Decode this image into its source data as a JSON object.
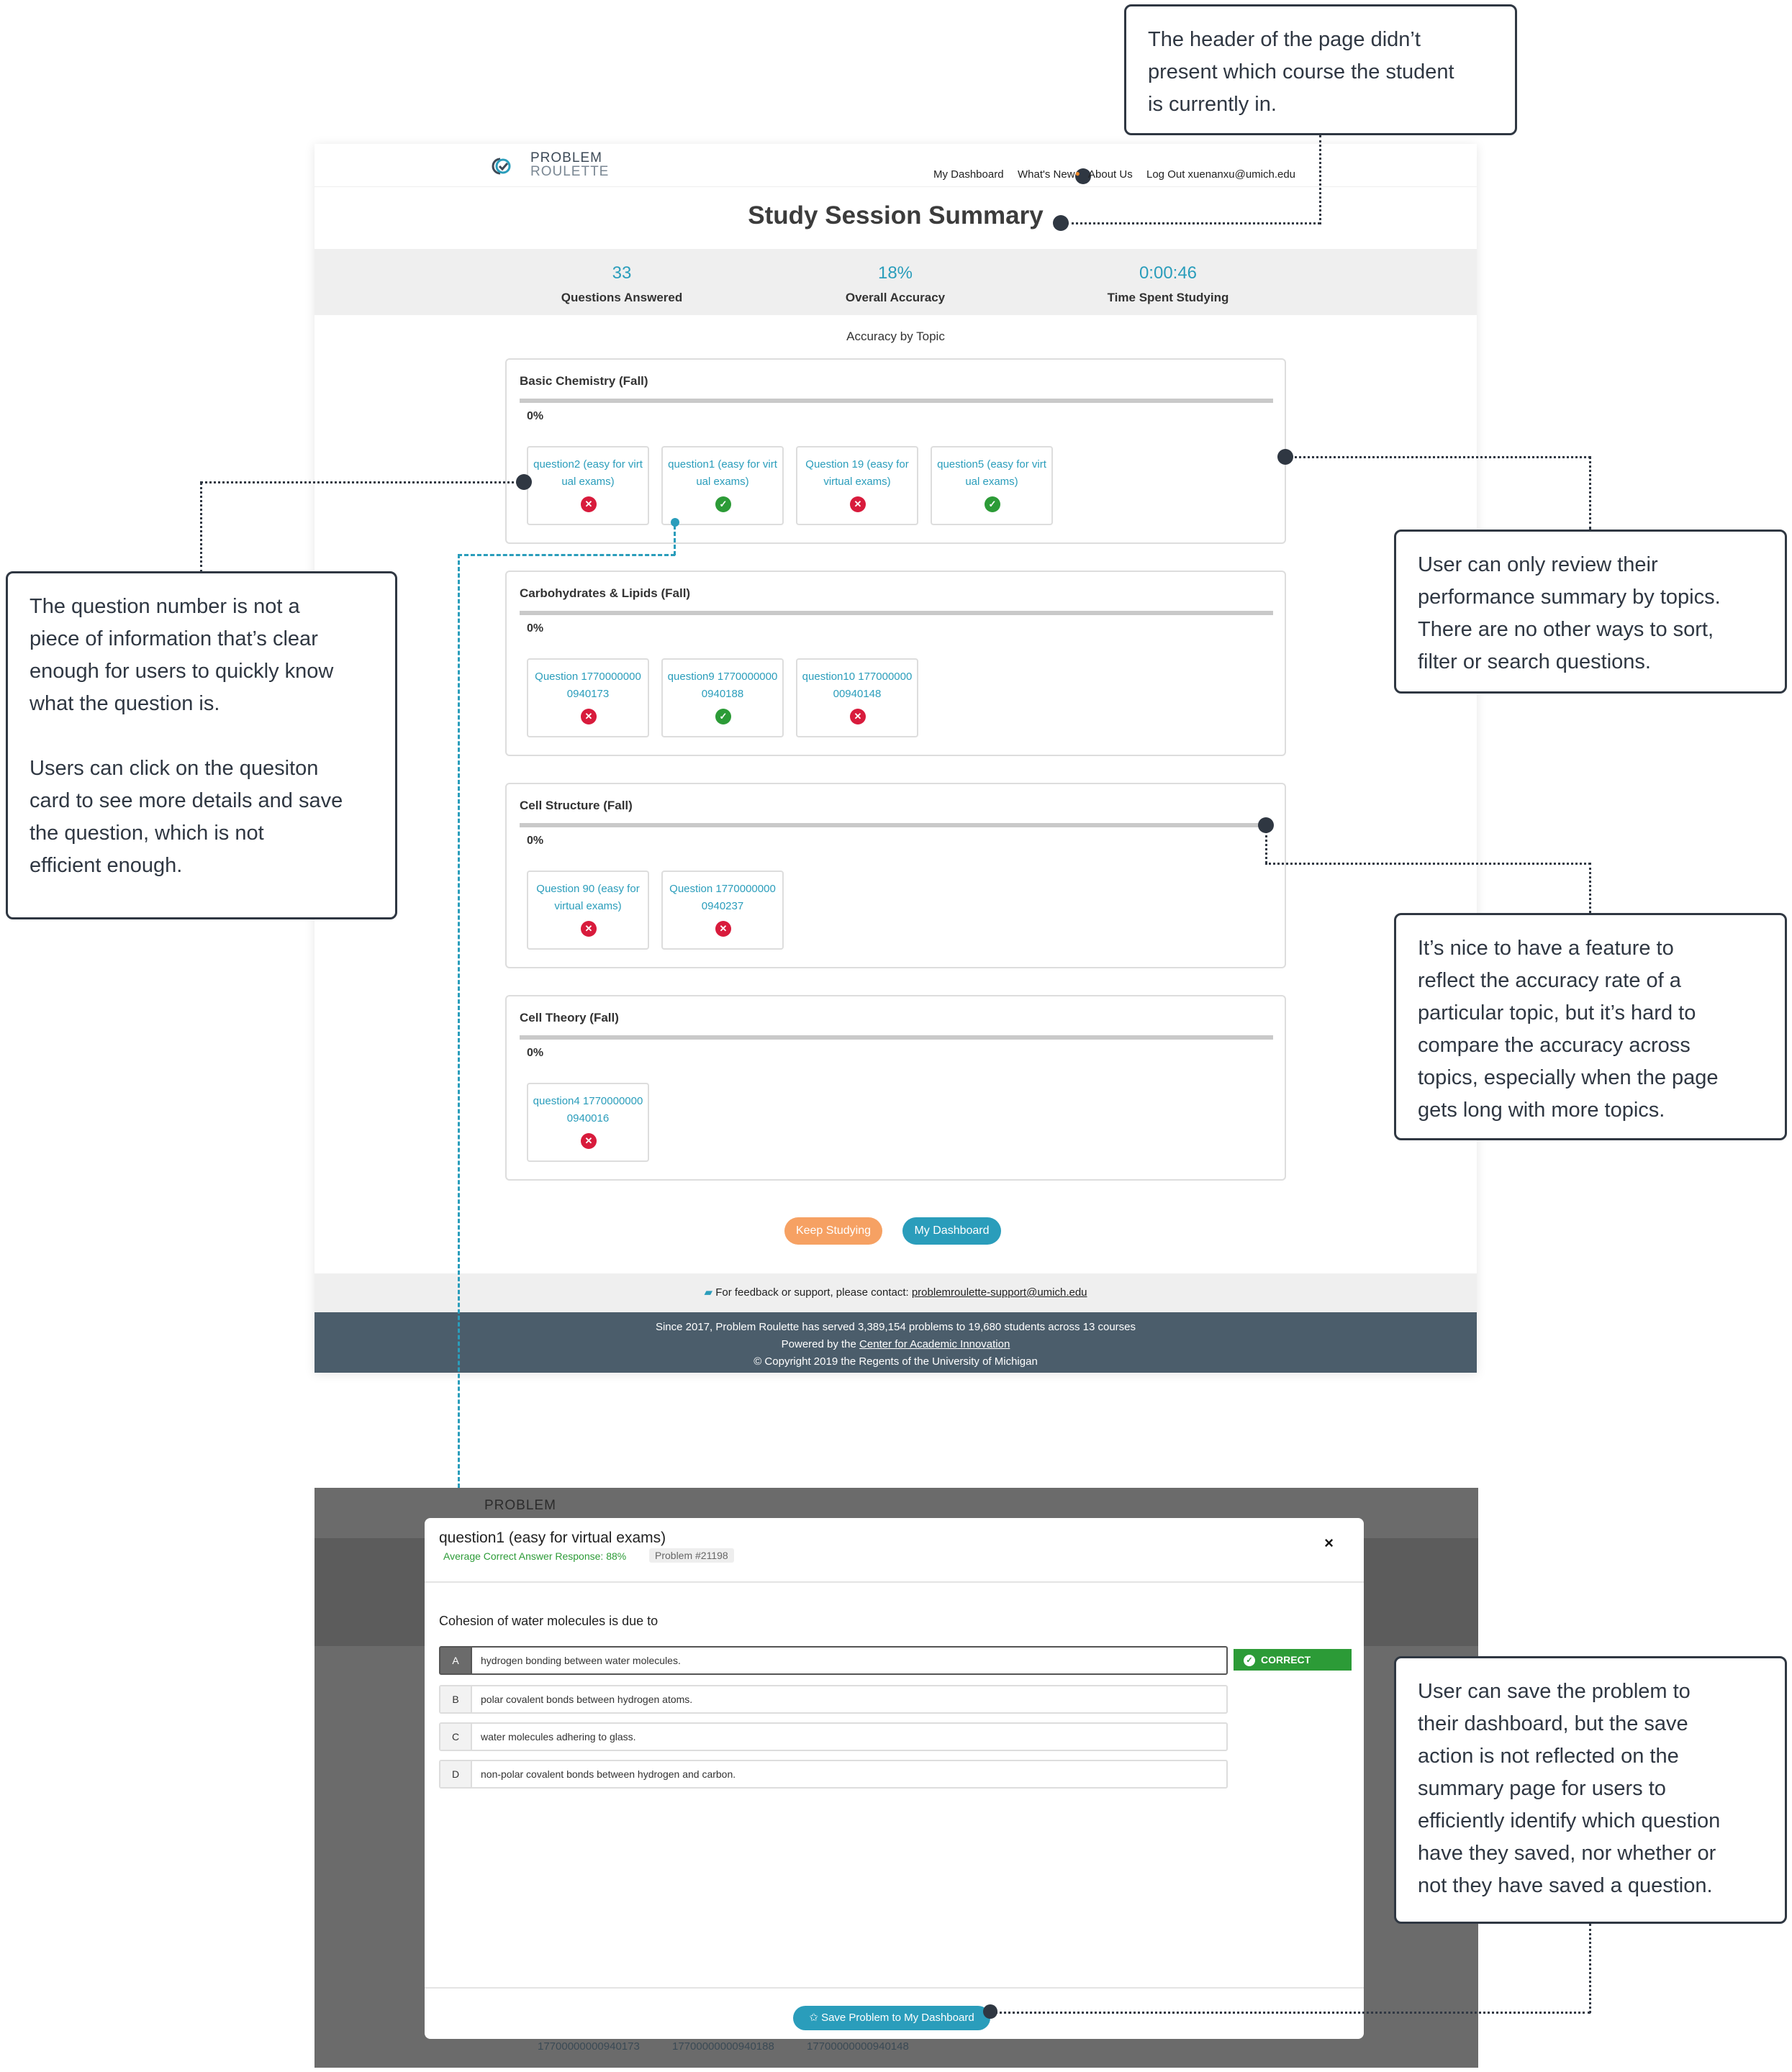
{
  "app": {
    "logo_line1": "PROBLEM",
    "logo_line2": "ROULETTE",
    "nav": [
      "My Dashboard",
      "What's New",
      "About Us",
      "Log Out xuenanxu@umich.edu"
    ]
  },
  "summary": {
    "title": "Study Session Summary",
    "stats": [
      {
        "value": "33",
        "label": "Questions Answered"
      },
      {
        "value": "18%",
        "label": "Overall Accuracy"
      },
      {
        "value": "0:00:46",
        "label": "Time Spent Studying"
      }
    ],
    "section_label": "Accuracy by Topic",
    "topics": [
      {
        "name": "Basic Chemistry (Fall)",
        "accuracy": "0%",
        "questions": [
          {
            "label": "question2 (easy for virtual exams)",
            "status": "wrong"
          },
          {
            "label": "question1 (easy for virtual exams)",
            "status": "correct"
          },
          {
            "label": "Question 19 (easy for virtual exams)",
            "status": "wrong"
          },
          {
            "label": "question5 (easy for virtual exams)",
            "status": "correct"
          }
        ]
      },
      {
        "name": "Carbohydrates & Lipids (Fall)",
        "accuracy": "0%",
        "questions": [
          {
            "label": "Question 17700000000940173",
            "status": "wrong"
          },
          {
            "label": "question9 17700000000940188",
            "status": "correct"
          },
          {
            "label": "question10 17700000000940148",
            "status": "wrong"
          }
        ]
      },
      {
        "name": "Cell Structure (Fall)",
        "accuracy": "0%",
        "questions": [
          {
            "label": "Question 90 (easy for virtual exams)",
            "status": "wrong"
          },
          {
            "label": "Question 17700000000940237",
            "status": "wrong"
          }
        ]
      },
      {
        "name": "Cell Theory (Fall)",
        "accuracy": "0%",
        "questions": [
          {
            "label": "question4 17700000000940016",
            "status": "wrong"
          }
        ]
      }
    ],
    "buttons": {
      "keep_studying": "Keep Studying",
      "my_dashboard": "My Dashboard"
    },
    "feedback_text": "For feedback or support, please contact: ",
    "feedback_email": "problemroulette-support@umich.edu",
    "footer_line1": "Since 2017, Problem Roulette has served 3,389,154 problems to 19,680 students across 13 courses",
    "footer_line2_prefix": "Powered by the ",
    "footer_line2_link": "Center for Academic Innovation",
    "footer_line3": "© Copyright 2019 the Regents of the University of Michigan"
  },
  "modal": {
    "title": "question1 (easy for virtual exams)",
    "avg_response": "Average Correct Answer Response: 88%",
    "problem_id": "Problem #21198",
    "close": "×",
    "question": "Cohesion of water molecules is due to",
    "options": [
      {
        "letter": "A",
        "text": "hydrogen bonding between water molecules.",
        "selected": true
      },
      {
        "letter": "B",
        "text": "polar covalent bonds between hydrogen atoms.",
        "selected": false
      },
      {
        "letter": "C",
        "text": "water molecules adhering to glass.",
        "selected": false
      },
      {
        "letter": "D",
        "text": "non-polar covalent bonds between hydrogen and carbon.",
        "selected": false
      }
    ],
    "correct_label": "CORRECT",
    "save_button": "✩ Save Problem to My Dashboard",
    "background_ids": [
      "17700000000940173",
      "17700000000940188",
      "17700000000940148"
    ]
  },
  "annotations": {
    "header": "The header of the page didn’t\npresent which course the student\nis currently in.",
    "question_number": "The question number is not a\npiece of information that’s clear\nenough for users to quickly know\nwhat the question is.\n\nUsers can click on the quesiton\ncard to see more details and save\nthe question, which is not\nefficient enough.",
    "topics_only": "User can only review their\nperformance summary by topics.\nThere are no other ways to sort,\nfilter or search questions.",
    "accuracy_rate": "It’s nice to have a feature to\nreflect the accuracy rate of a\nparticular topic, but it’s hard to\ncompare the accuracy across\ntopics, especially when the page\ngets long with more topics.",
    "save_problem": "User can save the problem to\ntheir dashboard, but the save\naction is not reflected on the\nsummary page for users to\nefficiently identify which question\nhave they saved, nor whether or\nnot they have saved a question."
  },
  "colors": {
    "accent": "#2a9dbb",
    "orange": "#f6a163",
    "correct": "#2c9b37",
    "wrong": "#d81b3c",
    "footer": "#4b5d6b",
    "annotation": "#2f3742"
  }
}
